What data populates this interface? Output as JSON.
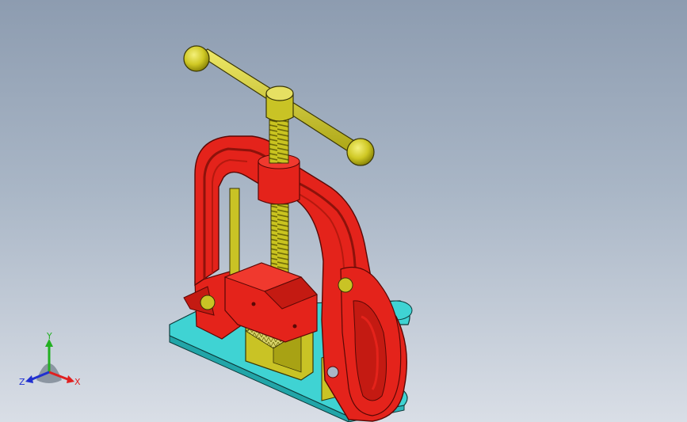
{
  "model": {
    "frame_color": "#e4231b",
    "frame_shadow": "#b01810",
    "handle_color": "#c8c21a",
    "base_color": "#3fd3d3",
    "jaw_color": "#c9c325"
  },
  "triad": {
    "x_label": "X",
    "y_label": "Y",
    "z_label": "Z",
    "x_color": "#e02020",
    "y_color": "#22b022",
    "z_color": "#2030d0"
  }
}
